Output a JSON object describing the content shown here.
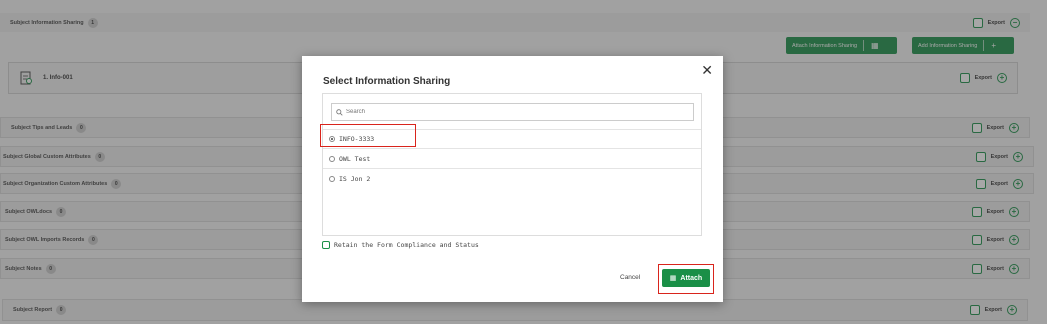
{
  "sections": {
    "info_sharing": {
      "title": "Subject Information Sharing",
      "count": "1",
      "export": "Export"
    },
    "tips": {
      "title": "Subject Tips and Leads",
      "count": "0",
      "export": "Export"
    },
    "global_attrs": {
      "title": "Subject Global Custom Attributes",
      "count": "0",
      "export": "Export"
    },
    "org_attrs": {
      "title": "Subject Organization Custom Attributes",
      "count": "0",
      "export": "Export"
    },
    "owldocs": {
      "title": "Subject OWLdocs",
      "count": "0",
      "export": "Export"
    },
    "owl_imports": {
      "title": "Subject OWL Imports Records",
      "count": "0",
      "export": "Export"
    },
    "notes": {
      "title": "Subject Notes",
      "count": "0",
      "export": "Export"
    },
    "report": {
      "title": "Subject Report",
      "count": "0",
      "export": "Export"
    }
  },
  "toolbar": {
    "attach_label": "Attach Information Sharing",
    "add_label": "Add Information Sharing"
  },
  "info_item": {
    "label": "1. Info-001",
    "export": "Export"
  },
  "modal": {
    "title": "Select Information Sharing",
    "search_placeholder": "Search",
    "options": [
      {
        "label": "INFO-3333",
        "selected": true
      },
      {
        "label": "OWL Test",
        "selected": false
      },
      {
        "label": "IS Jon 2",
        "selected": false
      }
    ],
    "retain_label": "Retain the Form Compliance and Status",
    "cancel_label": "Cancel",
    "attach_label": "Attach"
  },
  "colors": {
    "accent": "#1a8f47",
    "highlight": "#d9241c"
  }
}
